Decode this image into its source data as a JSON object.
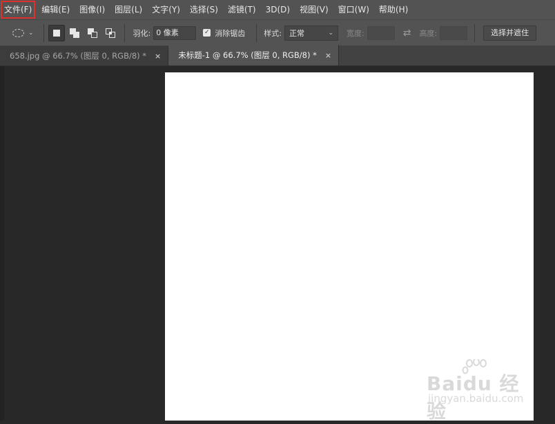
{
  "menu": [
    {
      "label": "文件(F)",
      "highlighted": true
    },
    {
      "label": "编辑(E)"
    },
    {
      "label": "图像(I)"
    },
    {
      "label": "图层(L)"
    },
    {
      "label": "文字(Y)"
    },
    {
      "label": "选择(S)"
    },
    {
      "label": "滤镜(T)"
    },
    {
      "label": "3D(D)"
    },
    {
      "label": "视图(V)"
    },
    {
      "label": "窗口(W)"
    },
    {
      "label": "帮助(H)"
    }
  ],
  "options": {
    "tool_icon": "elliptical-marquee-icon",
    "selection_modes": [
      "new-selection-icon",
      "add-to-selection-icon",
      "subtract-from-selection-icon",
      "intersect-selection-icon"
    ],
    "active_mode": "new-selection",
    "feather_label": "羽化:",
    "feather_value": "0 像素",
    "antialias_label": "消除锯齿",
    "antialias_checked": true,
    "style_label": "样式:",
    "style_value": "正常",
    "width_label": "宽度:",
    "width_value": "",
    "swap_icon": "swap-arrows-icon",
    "height_label": "高度:",
    "height_value": "",
    "select_mask_button": "选择并遮住"
  },
  "tabs": [
    {
      "label": "658.jpg @ 66.7% (图层 0, RGB/8) *",
      "active": false
    },
    {
      "label": "未标题-1 @ 66.7% (图层 0, RGB/8) *",
      "active": true
    }
  ],
  "watermark": {
    "line1": "Baidu 经验",
    "line2": "jingyan.baidu.com"
  },
  "colors": {
    "highlight": "#e0302a",
    "canvas": "#ffffff",
    "workspace": "#282828",
    "chrome": "#535353"
  }
}
